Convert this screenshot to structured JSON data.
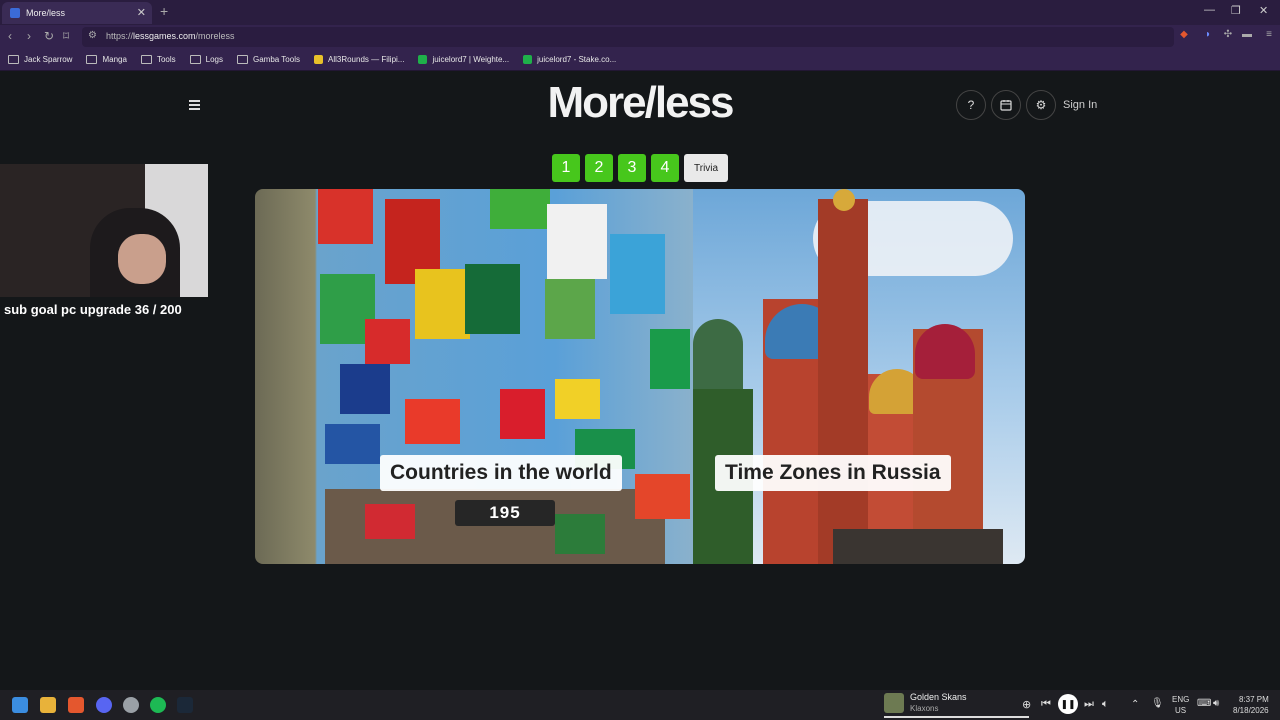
{
  "browser": {
    "tab_title": "More/less",
    "tab_close": "✕",
    "new_tab": "+",
    "url_prefix": "https://",
    "url_host": "lessgames.com",
    "url_path": "/moreless",
    "bookmarks": [
      {
        "label": "Jack Sparrow",
        "type": "folder"
      },
      {
        "label": "Manga",
        "type": "folder"
      },
      {
        "label": "Tools",
        "type": "folder"
      },
      {
        "label": "Logs",
        "type": "folder"
      },
      {
        "label": "Gamba Tools",
        "type": "folder"
      },
      {
        "label": "All3Rounds — Filipi...",
        "type": "site",
        "color": "#e8c12a"
      },
      {
        "label": "juicelord7 | Weighte...",
        "type": "site",
        "color": "#1fb04a"
      },
      {
        "label": "juicelord7 - Stake.co...",
        "type": "site",
        "color": "#1fb04a"
      }
    ]
  },
  "page": {
    "logo": "More/less",
    "help_glyph": "?",
    "sign_in": "Sign In",
    "levels": [
      "1",
      "2",
      "3",
      "4"
    ],
    "trivia_label": "Trivia",
    "left_card": {
      "title": "Countries in the world",
      "value": "195"
    },
    "right_card": {
      "title": "Time Zones in Russia"
    }
  },
  "stream": {
    "sub_goal": "sub goal pc upgrade 36 / 200"
  },
  "taskbar": {
    "now_playing_title": "Golden Skans",
    "now_playing_artist": "Klaxons",
    "lang": "ENG",
    "region": "US",
    "time": "8:37 PM",
    "date": "8/18/2026"
  },
  "colors": {
    "level_green": "#47c71c",
    "page_bg": "#141719",
    "browser_purple": "#33234d"
  }
}
